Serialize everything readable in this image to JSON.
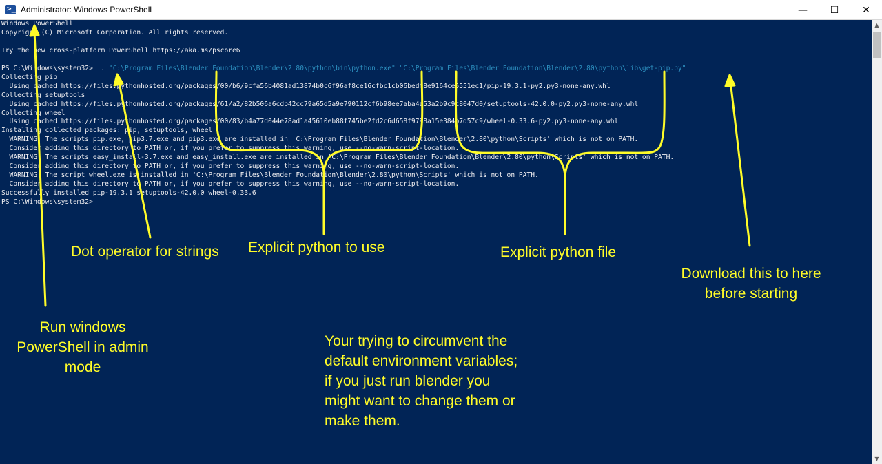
{
  "window": {
    "title": "Administrator: Windows PowerShell",
    "minimize_glyph": "—",
    "maximize_glyph": "☐",
    "close_glyph": "✕"
  },
  "console": {
    "pre_command": "Windows PowerShell\nCopyright (C) Microsoft Corporation. All rights reserved.\n\nTry the new cross-platform PowerShell https://aka.ms/pscore6\n\nPS C:\\Windows\\system32>  . ",
    "command_string": "\"C:\\Program Files\\Blender Foundation\\Blender\\2.80\\python\\bin\\python.exe\" \"C:\\Program Files\\Blender Foundation\\Blender\\2.80\\python\\lib\\get-pip.py\"",
    "post_command": "\nCollecting pip\n  Using cached https://files.pythonhosted.org/packages/00/b6/9cfa56b4081ad13874b0c6f96af8ce16cfbc1cb06bedf8e9164ce5551ec1/pip-19.3.1-py2.py3-none-any.whl\nCollecting setuptools\n  Using cached https://files.pythonhosted.org/packages/61/a2/82b506a6cdb42cc79a65d5a9e790112cf6b98ee7aba4a53a2b9c9c8047d0/setuptools-42.0.0-py2.py3-none-any.whl\nCollecting wheel\n  Using cached https://files.pythonhosted.org/packages/00/83/b4a77d044e78ad1a45610eb88f745be2fd2c6d658f9798a15e384b7d57c9/wheel-0.33.6-py2.py3-none-any.whl\nInstalling collected packages: pip, setuptools, wheel\n  WARNING: The scripts pip.exe, pip3.7.exe and pip3.exe are installed in 'C:\\Program Files\\Blender Foundation\\Blender\\2.80\\python\\Scripts' which is not on PATH.\n  Consider adding this directory to PATH or, if you prefer to suppress this warning, use --no-warn-script-location.\n  WARNING: The scripts easy_install-3.7.exe and easy_install.exe are installed in 'C:\\Program Files\\Blender Foundation\\Blender\\2.80\\python\\Scripts' which is not on PATH.\n  Consider adding this directory to PATH or, if you prefer to suppress this warning, use --no-warn-script-location.\n  WARNING: The script wheel.exe is installed in 'C:\\Program Files\\Blender Foundation\\Blender\\2.80\\python\\Scripts' which is not on PATH.\n  Consider adding this directory to PATH or, if you prefer to suppress this warning, use --no-warn-script-location.\nSuccessfully installed pip-19.3.1 setuptools-42.0.0 wheel-0.33.6\nPS C:\\Windows\\system32>"
  },
  "annotations": {
    "admin_mode": "Run windows\nPowerShell in admin\nmode",
    "dot_operator": "Dot operator for strings",
    "explicit_python": "Explicit python to use",
    "explicit_file": "Explicit python file",
    "download": "Download this to here\nbefore starting",
    "env_vars": "Your trying to circumvent the\ndefault environment variables;\nif you just run blender you\nmight want to change them or\nmake them."
  },
  "colors": {
    "console_bg": "#012456",
    "console_text": "#eeedf0",
    "command_string": "#2d8fbf",
    "annotation": "#fffc28"
  },
  "icons": {
    "app": "powershell-icon",
    "minimize": "minimize-icon",
    "maximize": "maximize-icon",
    "close": "close-icon",
    "scroll_up": "scroll-up-arrow-icon",
    "scroll_down": "scroll-down-arrow-icon"
  }
}
